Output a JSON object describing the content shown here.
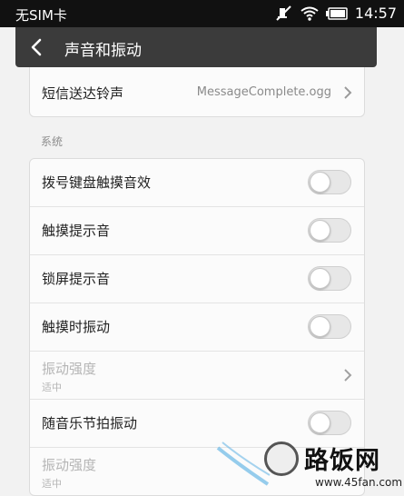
{
  "status_bar": {
    "carrier": "无SIM卡",
    "time": "14:57",
    "icons": [
      "mute-icon",
      "wifi-icon",
      "battery-icon"
    ]
  },
  "header": {
    "title": "声音和振动"
  },
  "top_card": {
    "label": "短信送达铃声",
    "value": "MessageComplete.ogg"
  },
  "section_title": "系统",
  "system_items": [
    {
      "label": "拨号键盘触摸音效",
      "on": false
    },
    {
      "label": "触摸提示音",
      "on": false
    },
    {
      "label": "锁屏提示音",
      "on": false
    },
    {
      "label": "触摸时振动",
      "on": false
    },
    {
      "label": "振动强度",
      "sub": "适中",
      "disabled": true
    },
    {
      "label": "随音乐节拍振动",
      "on": false
    },
    {
      "label": "振动强度",
      "sub": "适中",
      "disabled": true
    }
  ],
  "watermark": {
    "text": "路饭网",
    "url": "www.45fan.com"
  },
  "colors": {
    "status_bar_bg": "#111111",
    "title_bar_bg": "#3b3b3b",
    "page_bg": "#f2f2f2",
    "card_bg": "#fbfbfb"
  }
}
